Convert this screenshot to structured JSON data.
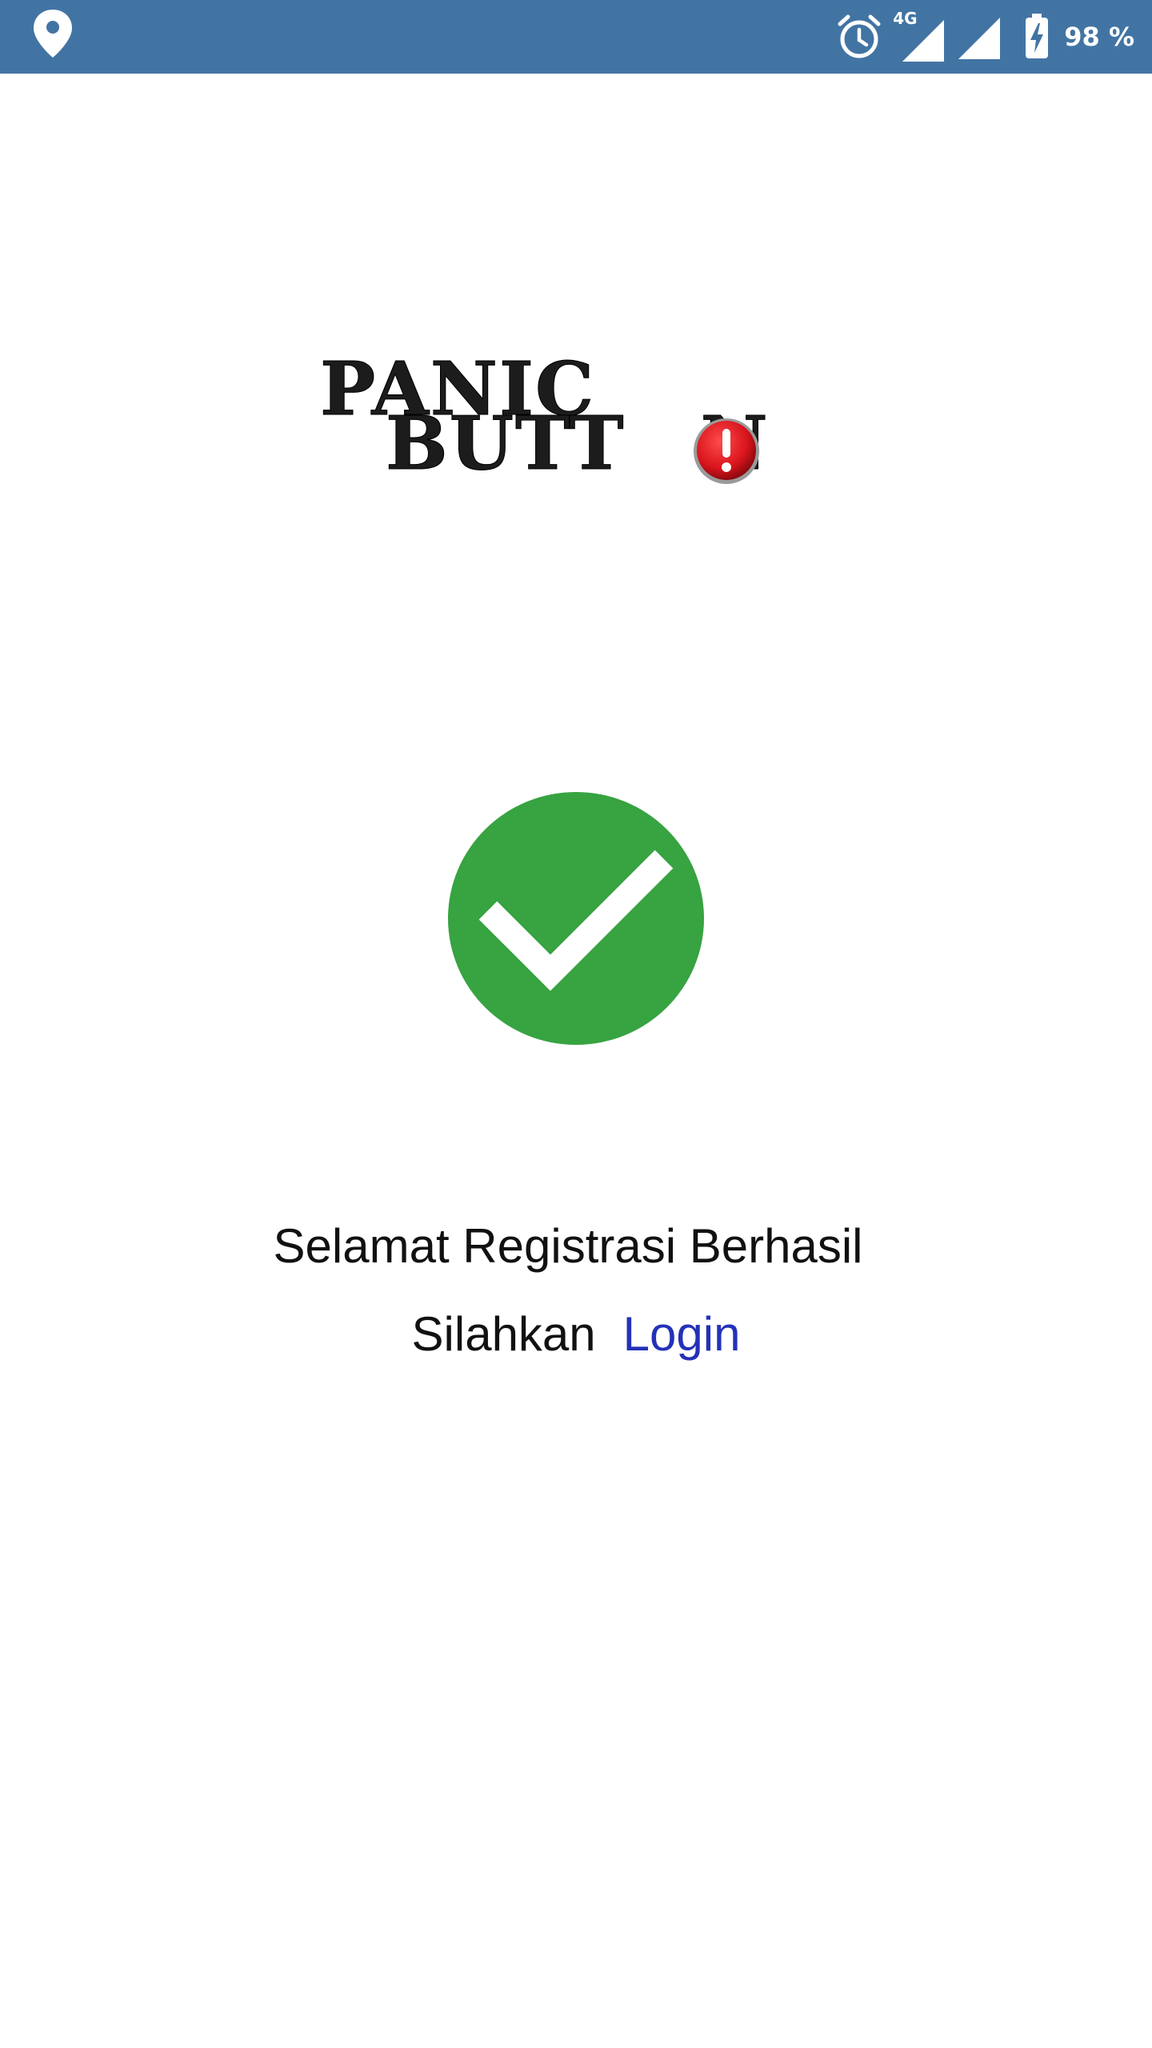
{
  "status_bar": {
    "network_type": "4G",
    "battery_percent": "98 %",
    "icons": [
      "location-icon",
      "alarm-icon",
      "signal-icon",
      "signal-icon",
      "battery-charging-icon"
    ],
    "background_color": "#4274a3"
  },
  "logo": {
    "line1": "PANIC",
    "line2_part1": "BUTT",
    "line2_part2": "N",
    "badge": "!",
    "badge_color": "#d8141c"
  },
  "success_icon": {
    "icon": "checkmark-circle-icon",
    "color": "#37a341"
  },
  "message": {
    "title": "Selamat Registrasi Berhasil",
    "prefix": "Silahkan",
    "login_link": "Login",
    "link_color": "#2431b8"
  }
}
